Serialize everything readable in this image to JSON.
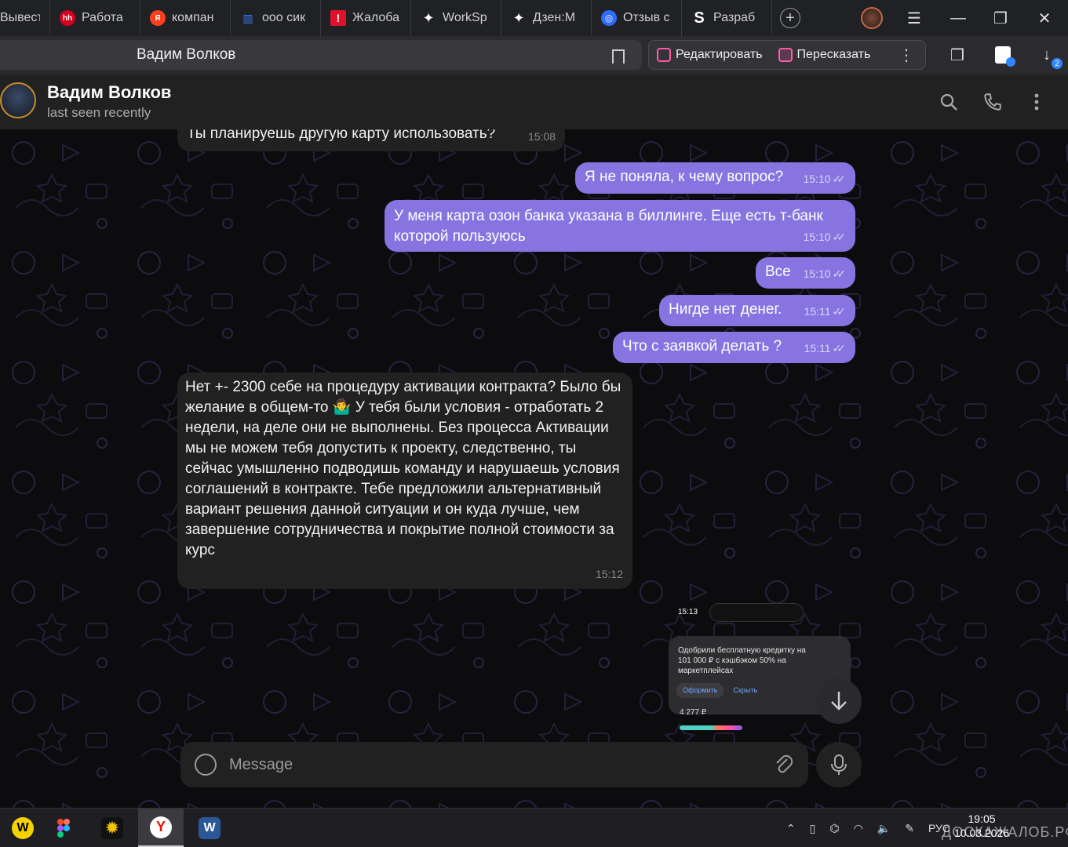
{
  "browser": {
    "tabs": [
      {
        "title": "Вывести",
        "icon": "tab-icon",
        "color": "#2b2b2f"
      },
      {
        "title": "Работа",
        "icon": "hh-icon",
        "color": "#d6001c"
      },
      {
        "title": "компан",
        "icon": "yandex-icon",
        "color": "#fc3f1d"
      },
      {
        "title": "ооо сик",
        "icon": "bank-icon",
        "color": "#3b7bff"
      },
      {
        "title": "Жалоба",
        "icon": "alert-icon",
        "color": "#e0112b"
      },
      {
        "title": "WorkSp",
        "icon": "sparkle-icon",
        "color": "#ffffff"
      },
      {
        "title": "Дзен:М",
        "icon": "sparkle-icon",
        "color": "#ffffff"
      },
      {
        "title": "Отзыв с",
        "icon": "review-icon",
        "color": "#2f6bff"
      },
      {
        "title": "Разраб",
        "icon": "dev-icon",
        "color": "#ffffff"
      }
    ],
    "address_title": "Вадим Волков",
    "actions": {
      "edit": "Редактировать",
      "retell": "Пересказать"
    },
    "downloads_badge": "2"
  },
  "chat": {
    "name": "Вадим Волков",
    "status": "last seen recently",
    "messages": [
      {
        "dir": "in",
        "text": "Ты планируешь другую карту использовать?",
        "time": "15:08"
      },
      {
        "dir": "out",
        "text": "Я не поняла, к чему вопрос?",
        "time": "15:10"
      },
      {
        "dir": "out",
        "text": "У меня карта озон банка указана в биллинге. Еще есть т-банк которой пользуюсь",
        "time": "15:10"
      },
      {
        "dir": "out",
        "text": "Все",
        "time": "15:10"
      },
      {
        "dir": "out",
        "text": "Нигде нет денег.",
        "time": "15:11"
      },
      {
        "dir": "out",
        "text": "Что с заявкой делать ?",
        "time": "15:11"
      },
      {
        "dir": "in",
        "text": "Нет +- 2300 себе на процедуру активации контракта? Было бы желание в общем-то 🤷‍♂️ У тебя были условия - отработать 2 недели, на деле они не выполнены. Без процесса Активации мы не можем тебя допустить к проекту, следственно, ты сейчас умышленно подводишь команду и нарушаешь условия соглашений в контракте. Тебе предложили альтернативный вариант решения данной ситуации и он куда лучше, чем завершение сотрудничества и покрытие полной стоимости за курс",
        "time": "15:12"
      }
    ],
    "screenshot": {
      "status_time": "15:13",
      "card_text": "Одобрили бесплатную кредитку на 101 000 ₽ с кэшбэком 50% на маркетплейсах",
      "btn_apply": "Оформить",
      "btn_hide": "Скрыть",
      "price": "4 277 ₽"
    },
    "composer_placeholder": "Message"
  },
  "taskbar": {
    "lang": "РУС",
    "time": "19:05",
    "date": "10.03.2026",
    "watermark": "ДОСКАЖАЛОБ.РФ"
  },
  "colors": {
    "outgoing": "#8774e1",
    "incoming": "#212121",
    "accent": "#8774e1"
  }
}
